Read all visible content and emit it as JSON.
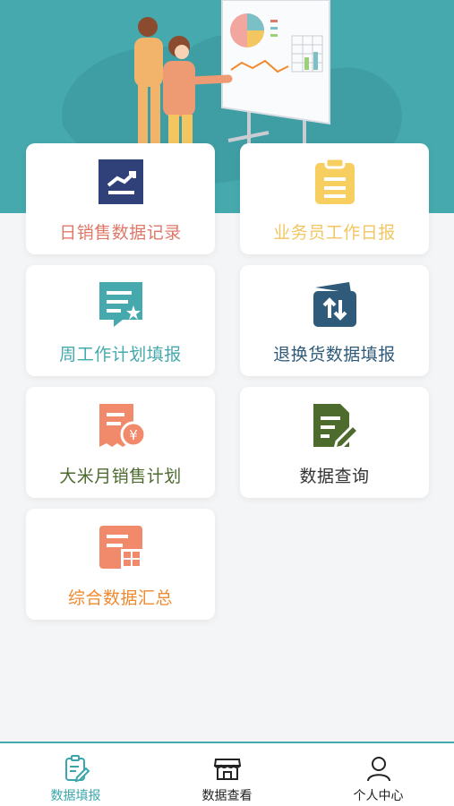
{
  "colors": {
    "accent": "#45a9ad",
    "background": "#f4f5f6",
    "tab_active": "#3aa6ab"
  },
  "hero": {
    "illustration": "team-presenting-charts"
  },
  "menu": {
    "items": [
      {
        "label": "日销售数据记录",
        "icon": "sales-trend-icon",
        "color": "#e0786a"
      },
      {
        "label": "业务员工作日报",
        "icon": "clipboard-icon",
        "color": "#f3c662"
      },
      {
        "label": "周工作计划填报",
        "icon": "weekly-plan-icon",
        "color": "#45a9ad"
      },
      {
        "label": "退换货数据填报",
        "icon": "return-exchange-icon",
        "color": "#2f5a79"
      },
      {
        "label": "大米月销售计划",
        "icon": "receipt-yuan-icon",
        "color": "#4e6b2e"
      },
      {
        "label": "数据查询",
        "icon": "document-edit-icon",
        "color": "#333333"
      },
      {
        "label": "综合数据汇总",
        "icon": "summary-grid-icon",
        "color": "#f08a2f"
      }
    ]
  },
  "tabbar": {
    "items": [
      {
        "label": "数据填报",
        "icon": "clipboard-edit-icon",
        "active": true
      },
      {
        "label": "数据查看",
        "icon": "storefront-icon",
        "active": false
      },
      {
        "label": "个人中心",
        "icon": "user-icon",
        "active": false
      }
    ]
  }
}
